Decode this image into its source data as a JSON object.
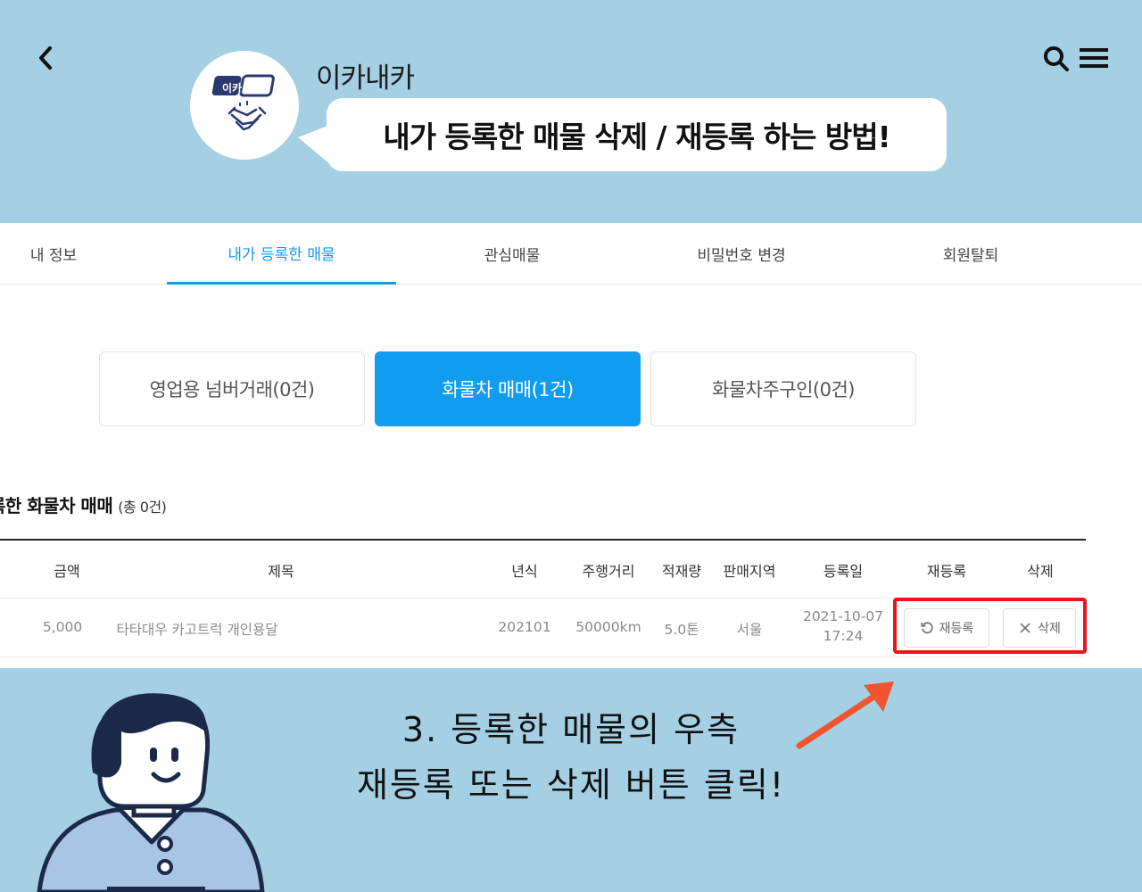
{
  "header": {
    "back_icon": "chevron-left-icon",
    "brand": "이카내카",
    "logo_text": "이카 내카",
    "headline": "내가 등록한 매물 삭제 / 재등록 하는 방법!"
  },
  "tabs": [
    "내 정보",
    "내가 등록한 매물",
    "관심매물",
    "비밀번호 변경",
    "회원탈퇴"
  ],
  "active_tab": "내가 등록한 매물",
  "segments": [
    "영업용 넘버거래(0건)",
    "화물차 매매(1건)",
    "화물차주구인(0건)"
  ],
  "active_segment": "화물차 매매(1건)",
  "list": {
    "title": "록한 화물차 매매",
    "count": "(총 0건)",
    "headers": [
      "금액",
      "제목",
      "년식",
      "주행거리",
      "적재량",
      "판매지역",
      "등록일",
      "재등록",
      "삭제"
    ],
    "row": {
      "price": "5,000",
      "title": "타타대우 카고트럭 개인용달",
      "year": "202101",
      "mileage": "50000km",
      "capacity": "5.0톤",
      "region": "서울",
      "date": "2021-10-07",
      "time": "17:24",
      "reregister_label": "재등록",
      "delete_label": "삭제"
    }
  },
  "caption": {
    "line1": "3. 등록한 매물의 우측",
    "line2": "재등록 또는 삭제 버튼 클릭!"
  },
  "colors": {
    "background": "#a5cfe3",
    "accent": "#119cf0",
    "highlight": "#e8161b",
    "arrow": "#f0552f",
    "logo_navy": "#2a3a6e"
  }
}
